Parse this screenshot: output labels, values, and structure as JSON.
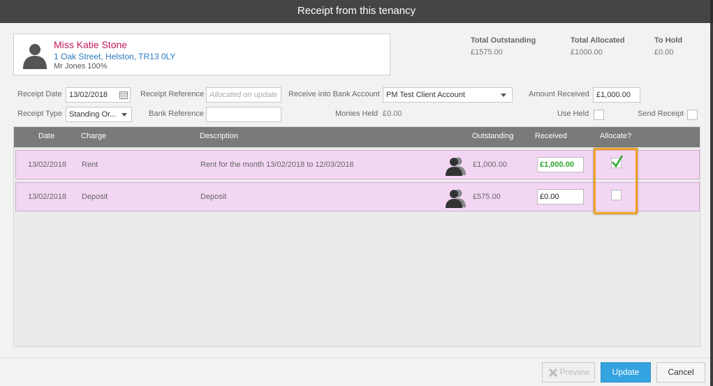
{
  "dialog": {
    "title": "Receipt from this tenancy"
  },
  "tenant": {
    "name": "Miss Katie Stone",
    "address": "1 Oak Street, Helston, TR13 0LY",
    "share": "Mr Jones 100%"
  },
  "totals": {
    "outstanding_label": "Total Outstanding",
    "outstanding_value": "£1575.00",
    "allocated_label": "Total Allocated",
    "allocated_value": "£1000.00",
    "hold_label": "To Hold",
    "hold_value": "£0.00"
  },
  "form": {
    "receipt_date_label": "Receipt Date",
    "receipt_date_value": "13/02/2018",
    "receipt_reference_label": "Receipt Reference",
    "receipt_reference_placeholder": "Allocated on update",
    "bank_account_label": "Receive into Bank Account",
    "bank_account_value": "PM Test Client Account",
    "amount_received_label": "Amount Received",
    "amount_received_value": "£1,000.00",
    "receipt_type_label": "Receipt Type",
    "receipt_type_value": "Standing Or...",
    "bank_reference_label": "Bank Reference",
    "bank_reference_value": "",
    "monies_held_label": "Monies Held",
    "monies_held_value": "£0.00",
    "use_held_label": "Use Held",
    "send_receipt_label": "Send Receipt"
  },
  "grid": {
    "columns": {
      "date": "Date",
      "charge": "Charge",
      "description": "Description",
      "outstanding": "Outstanding",
      "received": "Received",
      "allocate": "Allocate?"
    },
    "rows": [
      {
        "date": "13/02/2018",
        "charge": "Rent",
        "description": "Rent for the month 13/02/2018 to 12/03/2018",
        "outstanding": "£1,000.00",
        "received": "£1,000.00",
        "allocated": true
      },
      {
        "date": "13/02/2018",
        "charge": "Deposit",
        "description": "Deposit",
        "outstanding": "£575.00",
        "received": "£0.00",
        "allocated": false
      }
    ]
  },
  "buttons": {
    "preview": "Preview",
    "update": "Update",
    "cancel": "Cancel"
  },
  "colors": {
    "title_bar": "#454545",
    "row_highlight": "#f3d6f3",
    "tenant_name": "#c2185b",
    "link": "#2a7abf",
    "primary_button": "#35a3e0",
    "focus_outline": "#f0a020",
    "check": "#2aa52a"
  }
}
